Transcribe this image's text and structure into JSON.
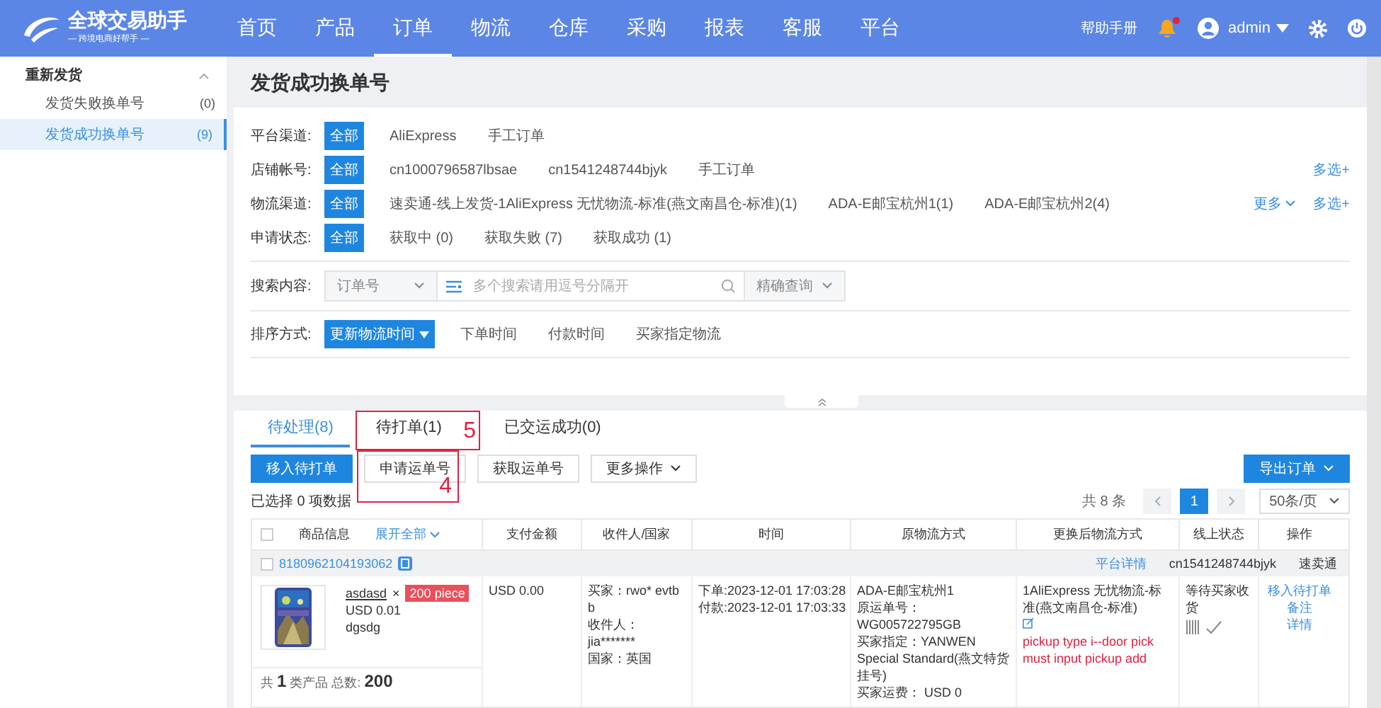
{
  "header": {
    "logo_title": "全球交易助手",
    "logo_subtitle": "— 跨境电商好帮手 —",
    "nav": [
      {
        "label": "首页",
        "selected": false
      },
      {
        "label": "产品",
        "selected": false
      },
      {
        "label": "订单",
        "selected": true
      },
      {
        "label": "物流",
        "selected": false
      },
      {
        "label": "仓库",
        "selected": false
      },
      {
        "label": "采购",
        "selected": false
      },
      {
        "label": "报表",
        "selected": false
      },
      {
        "label": "客服",
        "selected": false
      },
      {
        "label": "平台",
        "selected": false
      }
    ],
    "help": "帮助手册",
    "notification_dot": true,
    "user": "admin"
  },
  "sidebar": {
    "group": "重新发货",
    "expanded": true,
    "items": [
      {
        "label": "发货失败换单号",
        "count": "(0)",
        "selected": false
      },
      {
        "label": "发货成功换单号",
        "count": "(9)",
        "selected": true
      }
    ]
  },
  "page_title": "发货成功换单号",
  "filters": [
    {
      "label": "平台渠道:",
      "options": [
        {
          "label": "全部",
          "selected": true
        },
        {
          "label": "AliExpress",
          "selected": false
        },
        {
          "label": "手工订单",
          "selected": false
        }
      ]
    },
    {
      "label": "店铺帐号:",
      "options": [
        {
          "label": "全部",
          "selected": true
        },
        {
          "label": "cn1000796587lbsae",
          "selected": false
        },
        {
          "label": "cn1541248744bjyk",
          "selected": false
        },
        {
          "label": "手工订单",
          "selected": false
        }
      ],
      "multi": "多选+"
    },
    {
      "label": "物流渠道:",
      "options": [
        {
          "label": "全部",
          "selected": true
        },
        {
          "label": "速卖通-线上发货-1AliExpress 无忧物流-标准(燕文南昌仓-标准)(1)",
          "selected": false
        },
        {
          "label": "ADA-E邮宝杭州1(1)",
          "selected": false
        },
        {
          "label": "ADA-E邮宝杭州2(4)",
          "selected": false
        }
      ],
      "more": "更多",
      "multi": "多选+"
    },
    {
      "label": "申请状态:",
      "options": [
        {
          "label": "全部",
          "selected": true
        },
        {
          "label": "获取中 (0)",
          "selected": false
        },
        {
          "label": "获取失败 (7)",
          "selected": false
        },
        {
          "label": "获取成功 (1)",
          "selected": false
        }
      ]
    }
  ],
  "search": {
    "label": "搜索内容:",
    "field_type": "订单号",
    "placeholder": "多个搜索请用逗号分隔开",
    "mode": "精确查询"
  },
  "sort": {
    "label": "排序方式:",
    "options": [
      {
        "label": "更新物流时间",
        "selected": true
      },
      {
        "label": "下单时间",
        "selected": false
      },
      {
        "label": "付款时间",
        "selected": false
      },
      {
        "label": "买家指定物流",
        "selected": false
      }
    ]
  },
  "tabs": [
    {
      "label": "待处理(8)",
      "selected": true
    },
    {
      "label": "待打单(1)",
      "selected": false
    },
    {
      "label": "已交运成功(0)",
      "selected": false
    }
  ],
  "actions": [
    {
      "label": "移入待打单",
      "kind": "primary"
    },
    {
      "label": "申请运单号",
      "kind": "plain"
    },
    {
      "label": "获取运单号",
      "kind": "plain"
    },
    {
      "label": "更多操作",
      "kind": "dropdown"
    }
  ],
  "export": "导出订单",
  "selected_info": "已选择 0 项数据",
  "pagination": {
    "total": "共 8 条",
    "page": "1",
    "page_size": "50条/页"
  },
  "annotations": [
    {
      "label": "5"
    },
    {
      "label": "4"
    }
  ],
  "table": {
    "select_all_checked": false,
    "columns": [
      "商品信息",
      "展开全部",
      "支付金额",
      "收件人/国家",
      "时间",
      "原物流方式",
      "更换后物流方式",
      "线上状态",
      "操作"
    ],
    "order": {
      "checked": false,
      "id": "8180962104193062",
      "platform_detail": "平台详情",
      "store": "cn1541248744bjyk",
      "channel": "速卖通",
      "product": {
        "name": "asdasd",
        "times": "×",
        "qty": "200 piece",
        "price": "USD 0.01",
        "sku": "dgsdg"
      },
      "payment": "USD 0.00",
      "recipient": [
        "买家：rwo* evtb b",
        "收件人：jia*******",
        "国家：英国"
      ],
      "times": [
        "下单:2023-12-01 17:03:28",
        "付款:2023-12-01 17:03:33"
      ],
      "orig_logistics": [
        "ADA-E邮宝杭州1",
        "原运单号：WG005722795GB",
        "买家指定：YANWEN Special Standard(燕文特货挂号)",
        "买家运费： USD 0"
      ],
      "new_logistics": "1AliExpress 无忧物流-标准(燕文南昌仓-标准)",
      "error": [
        "pickup type i--door pick",
        "must input pickup add"
      ],
      "status": "等待买家收货",
      "ops": [
        "移入待打单",
        "备注",
        "详情"
      ],
      "summary": "共 **1** 类产品  总数: **200**"
    }
  }
}
